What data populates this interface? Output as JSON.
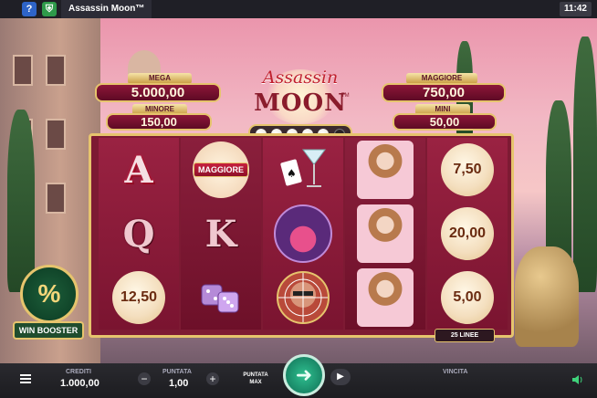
{
  "topbar": {
    "title": "Assassin Moon™",
    "clock": "11:42",
    "help_icon": "question-icon",
    "game_icon": "shield-icon"
  },
  "logo": {
    "line1": "Assassin",
    "line2": "MOON",
    "tm": "TM"
  },
  "jackpots": {
    "mega": {
      "label": "MEGA",
      "value": "5.000,00"
    },
    "minore": {
      "label": "MINORE",
      "value": "150,00"
    },
    "maggiore": {
      "label": "MAGGIORE",
      "value": "750,00"
    },
    "mini": {
      "label": "MINI",
      "value": "50,00"
    }
  },
  "moon_meter": {
    "filled": 5,
    "total": 6
  },
  "reels": [
    [
      {
        "type": "letter",
        "text": "A"
      },
      {
        "type": "letter",
        "text": "Q"
      },
      {
        "type": "moon",
        "text": "12,50"
      }
    ],
    [
      {
        "type": "maggiore",
        "text": "MAGGIORE"
      },
      {
        "type": "letter",
        "text": "K"
      },
      {
        "type": "icon",
        "text": "dice-icon"
      }
    ],
    [
      {
        "type": "icon",
        "text": "martini-cards-icon"
      },
      {
        "type": "icon",
        "text": "sports-car-icon"
      },
      {
        "type": "icon",
        "text": "target-villain-icon"
      }
    ],
    [
      {
        "type": "lady",
        "text": "assassin-woman-icon"
      },
      {
        "type": "lady",
        "text": "assassin-woman-icon"
      },
      {
        "type": "lady",
        "text": "assassin-woman-icon"
      }
    ],
    [
      {
        "type": "moon",
        "text": "7,50"
      },
      {
        "type": "moon",
        "text": "20,00"
      },
      {
        "type": "moon",
        "text": "5,00"
      }
    ]
  ],
  "lines_label": "25 LINEE",
  "win_booster": {
    "label": "WIN BOOSTER",
    "symbol": "%"
  },
  "bottombar": {
    "credits_caption": "CREDITI",
    "credits_value": "1.000,00",
    "bet_caption": "PUNTATA",
    "bet_value": "1,00",
    "minus": "−",
    "plus": "+",
    "max_bet_label": "PUNTATA MAX",
    "win_caption": "VINCITA",
    "menu_icon": "menu-icon",
    "sound_icon": "speaker-icon"
  },
  "colors": {
    "accent_gold": "#e6c46d",
    "reel_red": "#8a1f3c",
    "spin_green": "#1fa07a"
  }
}
